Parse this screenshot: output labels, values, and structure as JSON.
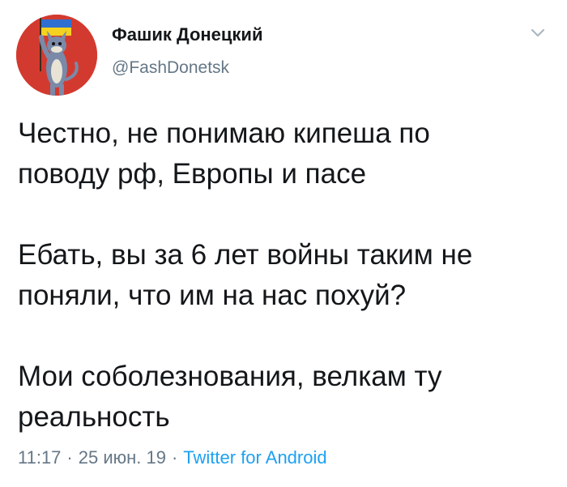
{
  "author": {
    "display_name": "Фашик Донецкий",
    "handle": "@FashDonetsk",
    "avatar_icon": "cartoon-cat-with-flag-avatar"
  },
  "menu": {
    "icon": "chevron-down-icon"
  },
  "tweet": {
    "paragraphs": [
      [
        "Честно, не понимаю кипеша по",
        "поводу рф, Европы и пасе"
      ],
      [
        "Ебать, вы за 6 лет войны таким не",
        "поняли, что им на нас похуй?"
      ],
      [
        "Мои соболезнования, велкам ту",
        "реальность"
      ]
    ]
  },
  "meta": {
    "time": "11:17",
    "separator": "·",
    "date": "25 июн. 19",
    "source": "Twitter for Android"
  },
  "colors": {
    "text": "#14171a",
    "secondary": "#657786",
    "link": "#1da1f2",
    "background": "#ffffff"
  }
}
